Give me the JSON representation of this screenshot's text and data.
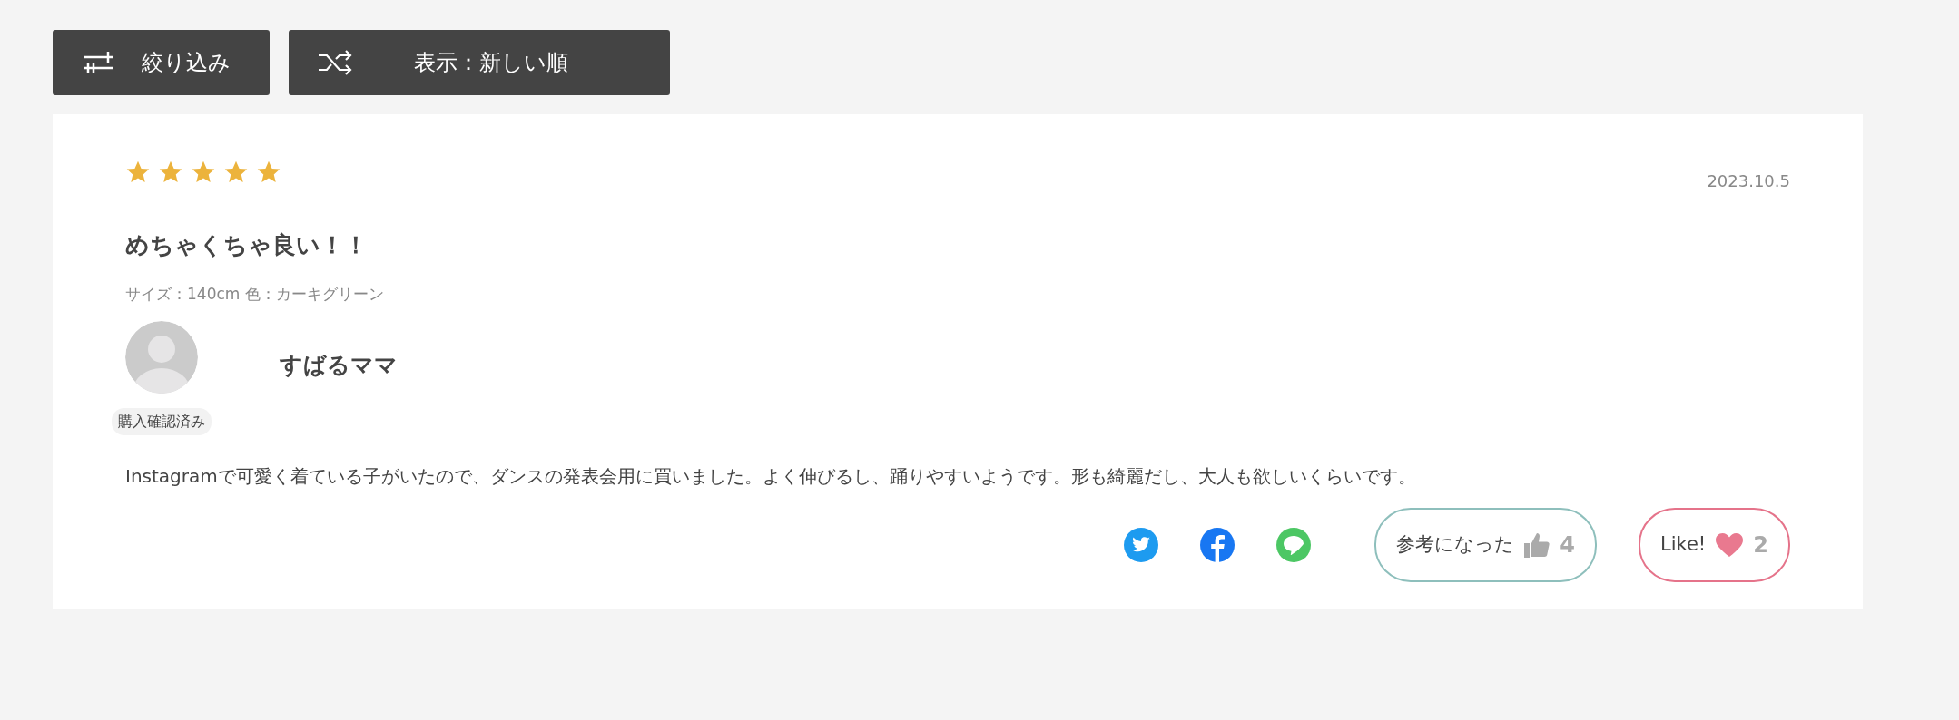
{
  "toolbar": {
    "filter_button": "絞り込み",
    "sort_button": "表示：新しい順"
  },
  "review": {
    "stars": 5,
    "date": "2023.10.5",
    "title": "めちゃくちゃ良い！！",
    "attributes": "サイズ：140cm 色：カーキグリーン",
    "reviewer": "すばるママ",
    "badge": "購入確認済み",
    "body": "Instagramで可愛く着ている子がいたので、ダンスの発表会用に買いました。よく伸びるし、踊りやすいようです。形も綺麗だし、大人も欲しいくらいです。",
    "helpful": {
      "label": "参考になった",
      "count": "4"
    },
    "like": {
      "label": "Like!",
      "count": "2"
    }
  }
}
